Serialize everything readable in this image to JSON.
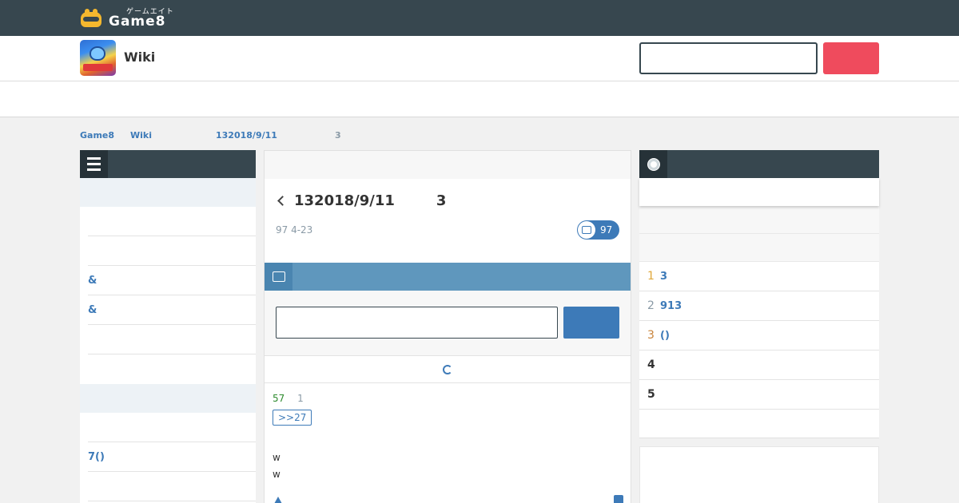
{
  "brand": {
    "kana": "ゲームエイト",
    "name": "Game8"
  },
  "site": {
    "title": "Wiki",
    "search_placeholder": "",
    "search_button": ""
  },
  "breadcrumb": {
    "items": [
      "Game8",
      "Wiki",
      "132018/9/11"
    ],
    "current": "3"
  },
  "sidebar": {
    "items": [
      {
        "label": ""
      },
      {
        "label": ""
      },
      {
        "label": ""
      },
      {
        "label": "&"
      },
      {
        "label": "&"
      },
      {
        "label": ""
      },
      {
        "label": ""
      },
      {
        "label": ""
      },
      {
        "label": ""
      },
      {
        "label": "7()"
      },
      {
        "label": ""
      }
    ]
  },
  "thread": {
    "title": "132018/9/11",
    "title_suffix": "3",
    "meta": "97 4-23",
    "comment_count": "97"
  },
  "post": {
    "input_value": "",
    "submit_label": ""
  },
  "comment": {
    "number": "57",
    "id": "1",
    "reply_ref": ">>27",
    "lines": [
      "w",
      "w"
    ]
  },
  "ranking": {
    "rows": [
      {
        "rank": "1",
        "label": "3"
      },
      {
        "rank": "2",
        "label": "913"
      },
      {
        "rank": "3",
        "label": "()"
      },
      {
        "rank": "4",
        "label": ""
      },
      {
        "rank": "5",
        "label": ""
      }
    ]
  },
  "colors": {
    "topbar": "#37474f",
    "accent": "#3d7ab8",
    "search_button": "#ef4b5d",
    "post_bar": "#5f97bd"
  }
}
